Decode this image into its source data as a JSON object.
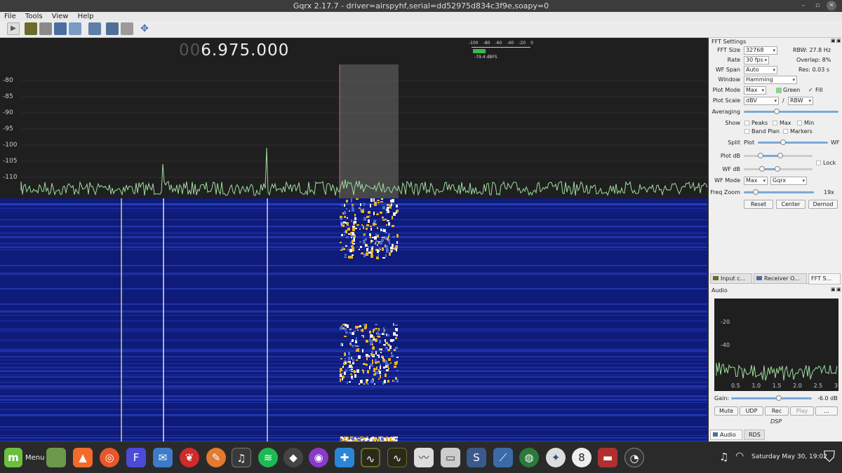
{
  "window": {
    "title": "Gqrx 2.17.7 - driver=airspyhf,serial=dd52975d834c3f9e,soapy=0"
  },
  "menu": [
    "File",
    "Tools",
    "View",
    "Help"
  ],
  "display": {
    "freq_dim": "00",
    "freq_main": "6.975.000",
    "meter_scale": [
      "-100",
      "-80",
      "-60",
      "-40",
      "-20",
      "0"
    ],
    "meter_value": "-79.4 dBFS",
    "y_ticks": [
      "-80",
      "-85",
      "-90",
      "-95",
      "-100",
      "-105",
      "-110"
    ]
  },
  "fft": {
    "title": "FFT Settings",
    "fft_size_label": "FFT Size",
    "fft_size": "32768",
    "rbw": "RBW: 27.8 Hz",
    "rate_label": "Rate",
    "rate": "30 fps",
    "overlap": "Overlap: 8%",
    "wf_span_label": "WF Span",
    "wf_span": "Auto",
    "res": "Res: 0.03 s",
    "window_label": "Window",
    "window": "Hamming",
    "plot_mode_label": "Plot Mode",
    "plot_mode": "Max",
    "green_label": "Green",
    "fill_label": "Fill",
    "plot_scale_label": "Plot Scale",
    "plot_scale": "dBV",
    "slash": "/",
    "rbw_sel": "RBW",
    "averaging_label": "Averaging",
    "show_label": "Show",
    "peaks": "Peaks",
    "max": "Max",
    "min": "Min",
    "band_plan": "Band Plan",
    "markers": "Markers",
    "split_label": "Split",
    "split_plot": "Plot",
    "split_wf": "WF",
    "plot_db_label": "Plot dB",
    "lock_label": "Lock",
    "wf_db_label": "WF dB",
    "wf_mode_label": "WF Mode",
    "wf_mode": "Max",
    "wf_palette": "Gqrx",
    "freq_zoom_label": "Freq Zoom",
    "freq_zoom": "19x",
    "reset": "Reset",
    "center": "Center",
    "demod": "Demod"
  },
  "dock_tabs": [
    "Input c...",
    "Receiver O...",
    "FFT S..."
  ],
  "audio": {
    "title": "Audio",
    "y_ticks": [
      "-20",
      "-40"
    ],
    "x_ticks": [
      "0.5",
      "1.0",
      "1.5",
      "2.0",
      "2.5",
      "3"
    ],
    "gain_label": "Gain:",
    "gain_value": "-6.0 dB",
    "mute": "Mute",
    "udp": "UDP",
    "rec": "Rec",
    "play": "Play",
    "more": "...",
    "dsp": "DSP",
    "tabs": [
      "Audio",
      "RDS"
    ]
  },
  "taskbar": {
    "menu_label": "Menu",
    "clock": "Saturday May 30, 19:02"
  },
  "colors": {
    "waterfall_bg": "#0f1b7a",
    "spectrum_line": "#9fdc9f",
    "accent": "#7aa9d8"
  }
}
